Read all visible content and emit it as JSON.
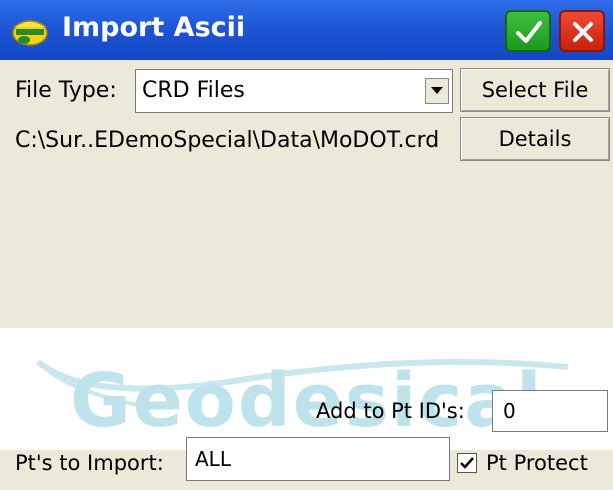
{
  "titlebar": {
    "title": "Import Ascii",
    "icon": "surveyor-helmet-icon",
    "accept_icon": "check-icon",
    "close_icon": "close-icon"
  },
  "file_type": {
    "label": "File Type:",
    "selected": "CRD Files"
  },
  "buttons": {
    "select_file": "Select File",
    "details": "Details"
  },
  "file_path": "C:\\Sur..EDemoSpecial\\Data\\MoDOT.crd",
  "watermark": "Geodesical",
  "add_to_pt_ids": {
    "label": "Add to Pt ID's:",
    "value": "0"
  },
  "pts_to_import": {
    "label": "Pt's to Import:",
    "value": "ALL"
  },
  "pt_protect": {
    "label": "Pt Protect",
    "checked": true
  },
  "colors": {
    "titlebar": "#1d56d6",
    "accept": "#1c9a1f",
    "close": "#c8210f",
    "window_bg": "#ece9d8"
  }
}
